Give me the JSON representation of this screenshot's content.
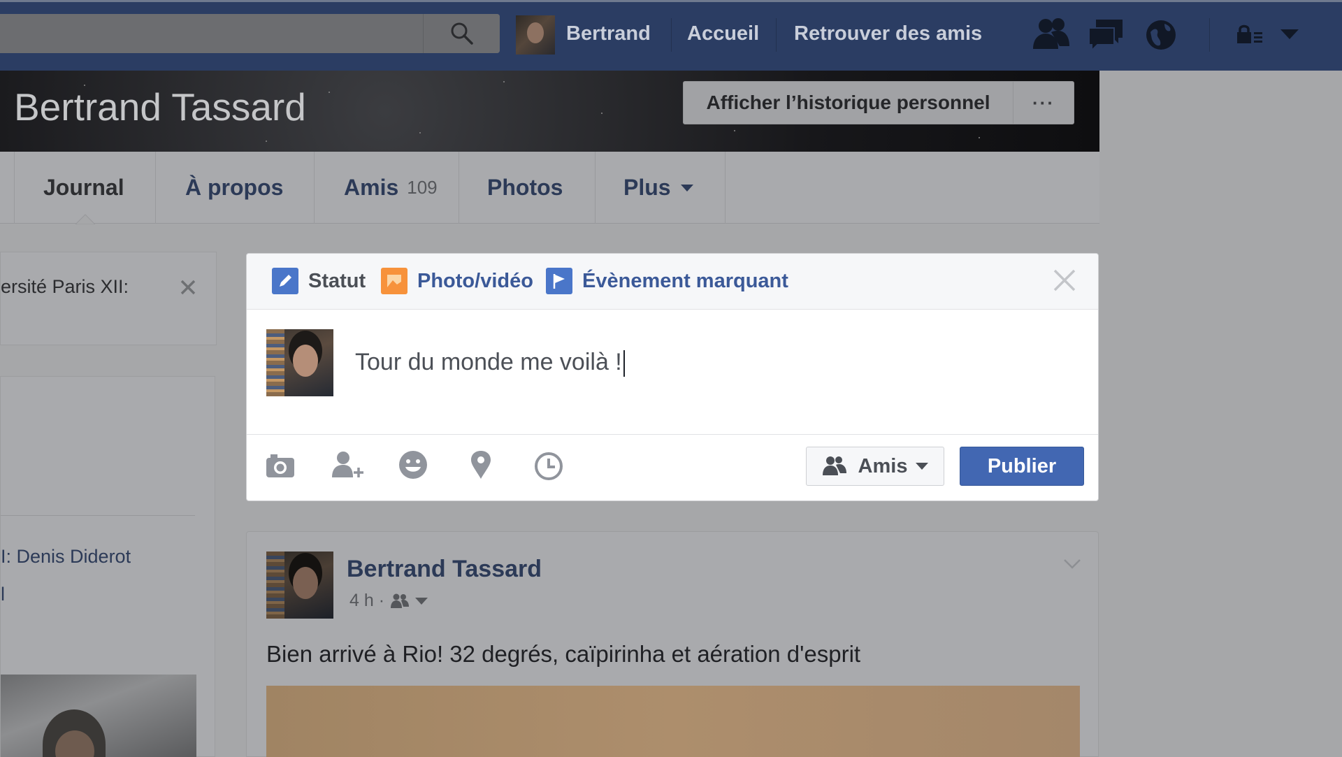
{
  "header": {
    "user_name": "Bertrand",
    "nav": {
      "home": "Accueil",
      "find_friends": "Retrouver des amis"
    }
  },
  "profile": {
    "name": "Bertrand Tassard",
    "history_button": "Afficher l’historique personnel",
    "more_button": "···"
  },
  "tabs": [
    {
      "label": "Journal"
    },
    {
      "label": "À propos"
    },
    {
      "label": "Amis",
      "count": "109"
    },
    {
      "label": "Photos"
    },
    {
      "label": "Plus"
    }
  ],
  "left": {
    "card_text": "ersité Paris XII:",
    "link1": "I: Denis Diderot",
    "link2": "l"
  },
  "composer": {
    "tabs": [
      {
        "label": "Statut"
      },
      {
        "label": "Photo/vidéo"
      },
      {
        "label": "Évènement marquant"
      }
    ],
    "text": "Tour du monde me voilà !",
    "audience": "Amis",
    "publish": "Publier"
  },
  "post": {
    "author": "Bertrand Tassard",
    "time": "4 h ·",
    "text": "Bien arrivé à Rio! 32 degrés, caïpirinha et aération d'esprit"
  },
  "colors": {
    "facebook_blue": "#4267b2",
    "topbar": "#2b3d63",
    "link": "#3b5998"
  }
}
